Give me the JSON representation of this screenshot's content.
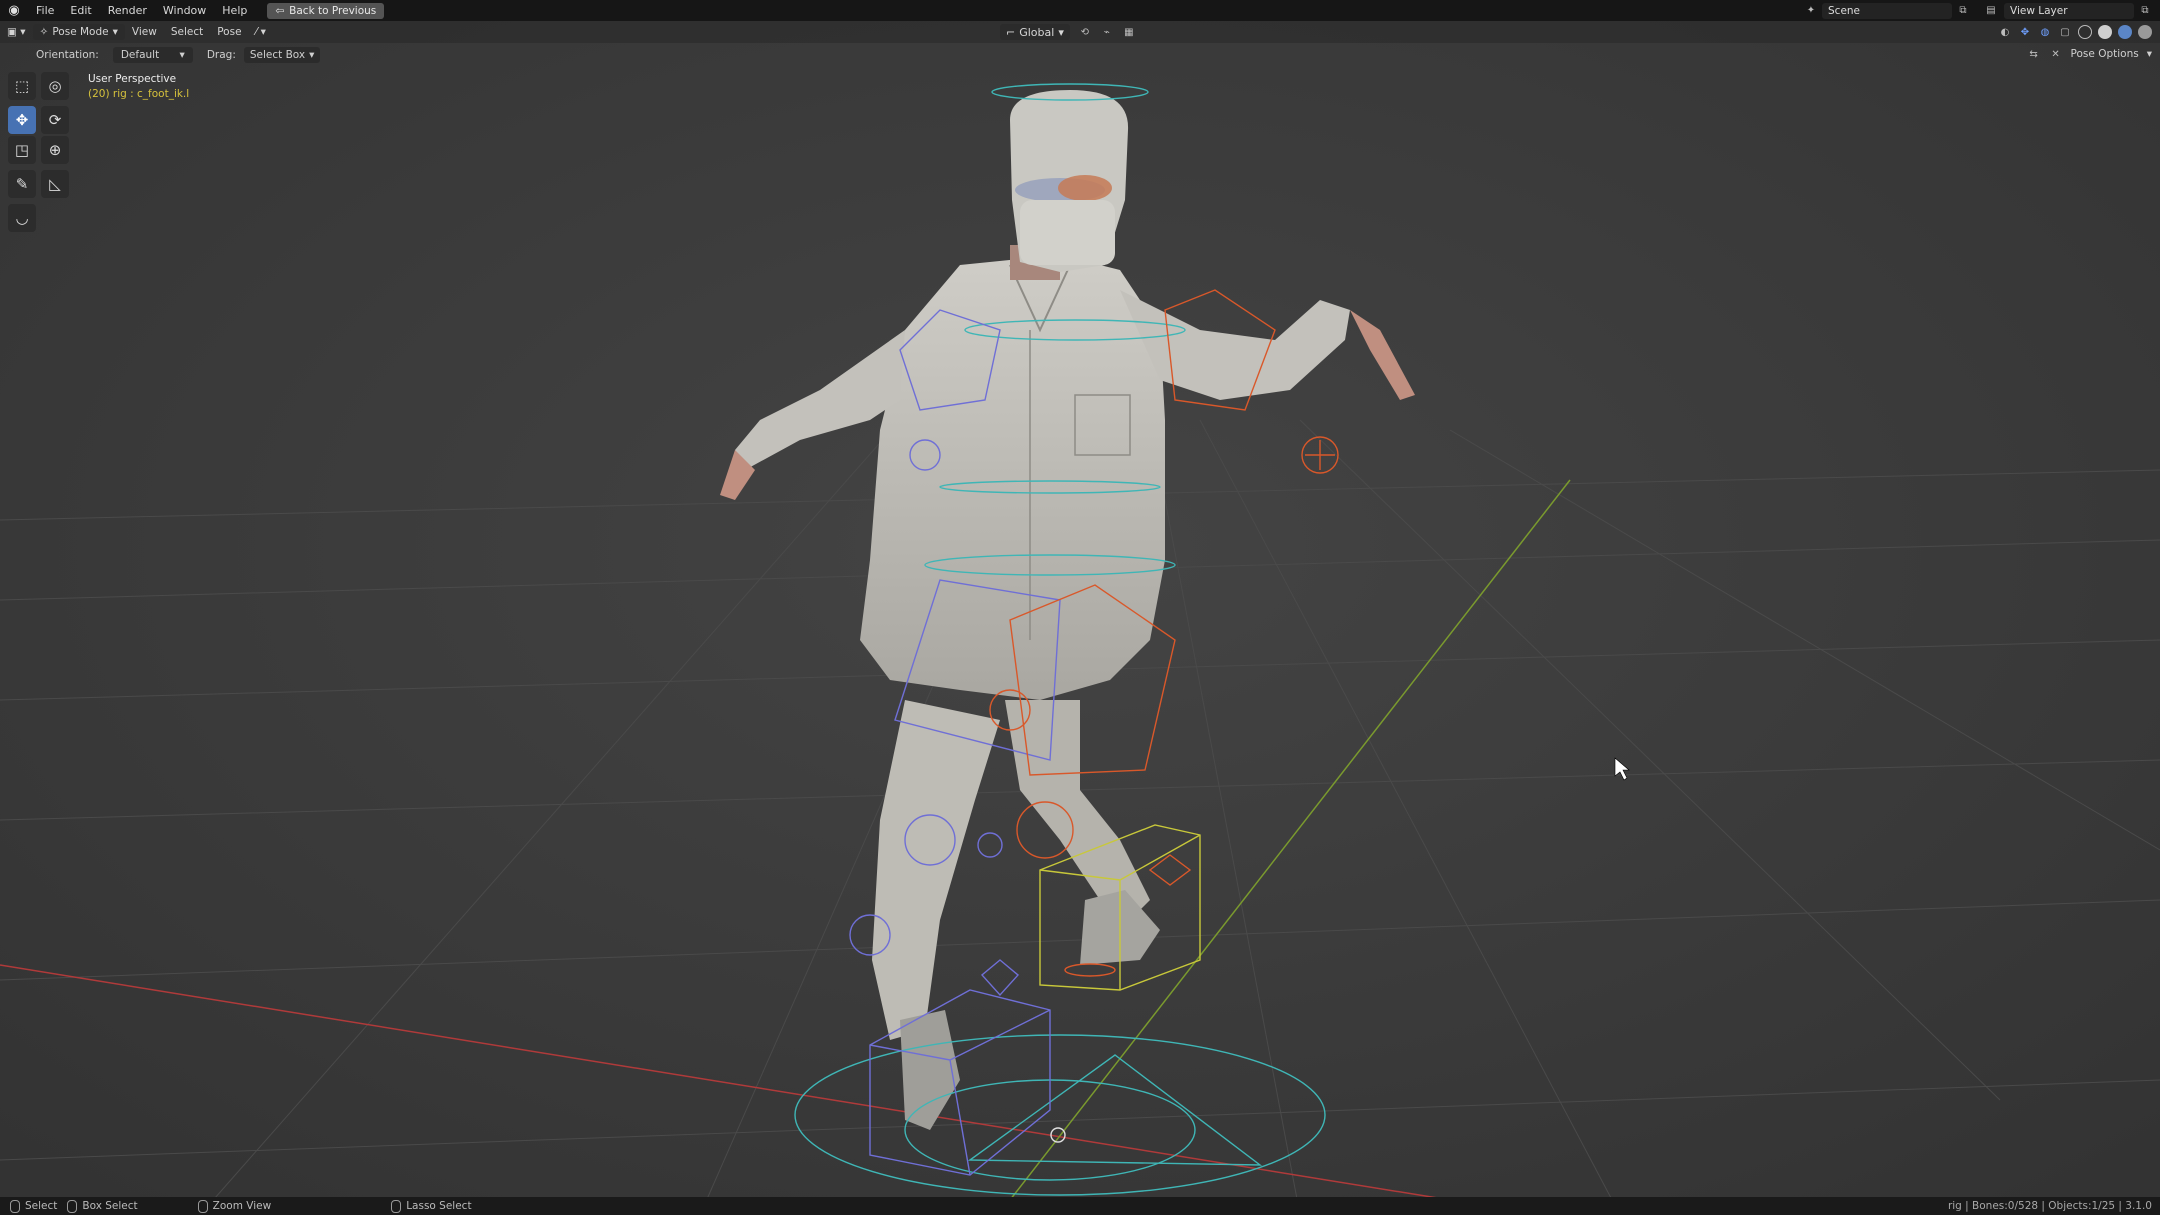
{
  "menubar": {
    "items": [
      "File",
      "Edit",
      "Render",
      "Window",
      "Help"
    ],
    "back_button": "Back to Previous",
    "scene_label": "Scene",
    "view_layer_label": "View Layer"
  },
  "viewport_header": {
    "mode": "Pose Mode",
    "menus": [
      "View",
      "Select",
      "Pose"
    ],
    "transform_orientation": "Global"
  },
  "tool_header": {
    "orientation_label": "Orientation:",
    "orientation_value": "Default",
    "drag_label": "Drag:",
    "drag_value": "Select Box",
    "pose_options": "Pose Options"
  },
  "viewport_overlay": {
    "view_name": "User Perspective",
    "active_object": "(20) rig : c_foot_ik.l"
  },
  "statusbar": {
    "select": "Select",
    "box_select": "Box Select",
    "zoom_view": "Zoom View",
    "lasso_select": "Lasso Select",
    "stats": "rig | Bones:0/528 | Objects:1/25 | 3.1.0"
  },
  "colors": {
    "background": "#3a3a3a",
    "topbar": "#161616",
    "active_tool": "#4772b3",
    "x_axis": "#b03a3a",
    "y_axis": "#7a9a2e",
    "bone_blue": "#6f6fd6",
    "bone_cyan": "#3fb6b6",
    "bone_orange": "#d9582a",
    "bone_yellow": "#c8c83a"
  },
  "icons": [
    "blender-logo-icon",
    "pose-mode-icon",
    "select-box-icon",
    "cursor-icon",
    "move-icon",
    "rotate-icon",
    "scale-icon",
    "transform-icon",
    "annotate-icon",
    "measure-icon",
    "relax-icon",
    "mouse-cursor-icon"
  ]
}
